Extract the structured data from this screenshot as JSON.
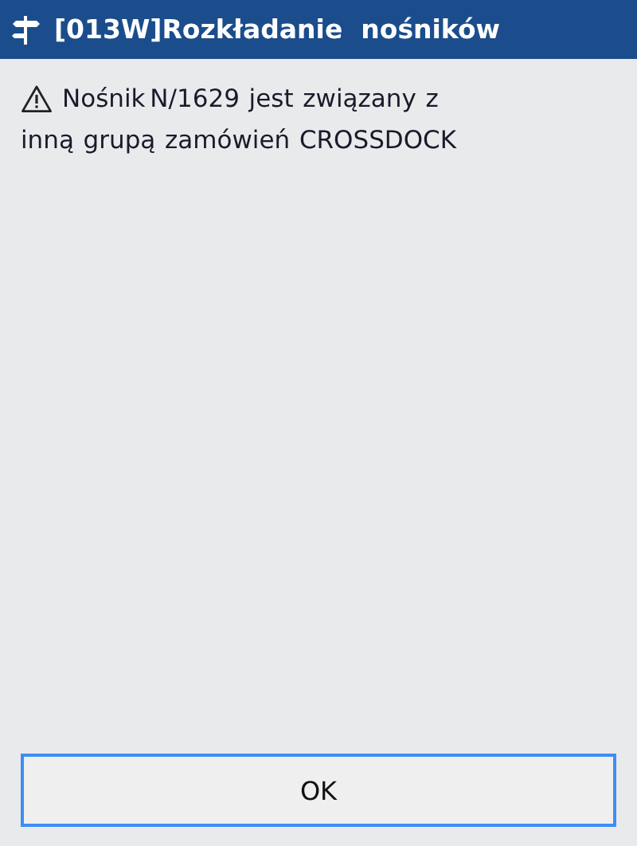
{
  "window": {
    "title": "[013W]Rozkładanie  nośników"
  },
  "message": {
    "kind": "warning",
    "lines": [
      "Nośnik N/1629  jest  związany  z",
      "inną  grupą  zamówień  CROSSDOCK"
    ]
  },
  "buttons": [
    {
      "label": "OK",
      "focused": true
    }
  ]
}
